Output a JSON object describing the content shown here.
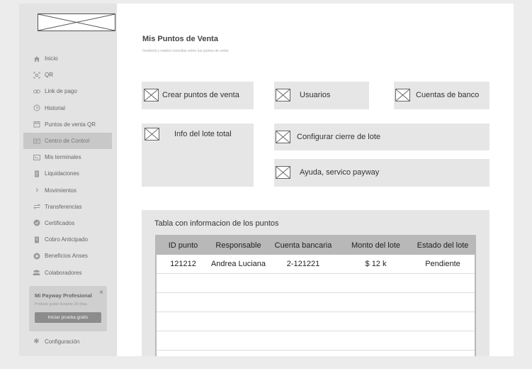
{
  "sidebar": {
    "items": [
      {
        "label": "Inicio",
        "icon": "home-icon"
      },
      {
        "label": "QR",
        "icon": "qr-icon"
      },
      {
        "label": "Link de pago",
        "icon": "link-icon"
      },
      {
        "label": "Historial",
        "icon": "history-icon"
      },
      {
        "label": "Puntos de venta QR",
        "icon": "store-icon"
      },
      {
        "label": "Centro de Control",
        "icon": "control-icon",
        "active": true
      },
      {
        "label": "Mis terminales",
        "icon": "terminal-icon"
      },
      {
        "label": "Liquidaciones",
        "icon": "document-icon"
      },
      {
        "label": "Movimientos",
        "icon": "chevron-right-icon"
      },
      {
        "label": "Transferencias",
        "icon": "transfer-icon"
      },
      {
        "label": "Certificados",
        "icon": "check-circle-icon"
      },
      {
        "label": "Cobro Anticipado",
        "icon": "receipt-icon"
      },
      {
        "label": "Beneficios Anses",
        "icon": "gift-icon"
      },
      {
        "label": "Colaboradores",
        "icon": "people-icon"
      }
    ],
    "promo": {
      "title": "Mi Payway Profesional",
      "subtitle": "Probalo gratis durante 30 días.",
      "button": "Iniciar prueba gratis"
    },
    "settings_label": "Configuración"
  },
  "main": {
    "title": "Mis Puntos de Venta",
    "subtitle": "Gestioná y realizá consultas sobre tus puntos de venta",
    "cards": {
      "crear": "Crear puntos de venta",
      "usuarios": "Usuarios",
      "cuentas": "Cuentas de banco",
      "info_lote": "Info del lote total",
      "cierre": "Configurar cierre de lote",
      "ayuda": "Ayuda, servico payway"
    },
    "table": {
      "title": "Tabla con informacion de los puntos",
      "headers": [
        "ID punto",
        "Responsable",
        "Cuenta bancaria",
        "Monto del lote",
        "Estado del lote"
      ],
      "rows": [
        [
          "121212",
          "Andrea Luciana",
          "2-121221",
          "$ 12 k",
          "Pendiente"
        ]
      ]
    }
  }
}
